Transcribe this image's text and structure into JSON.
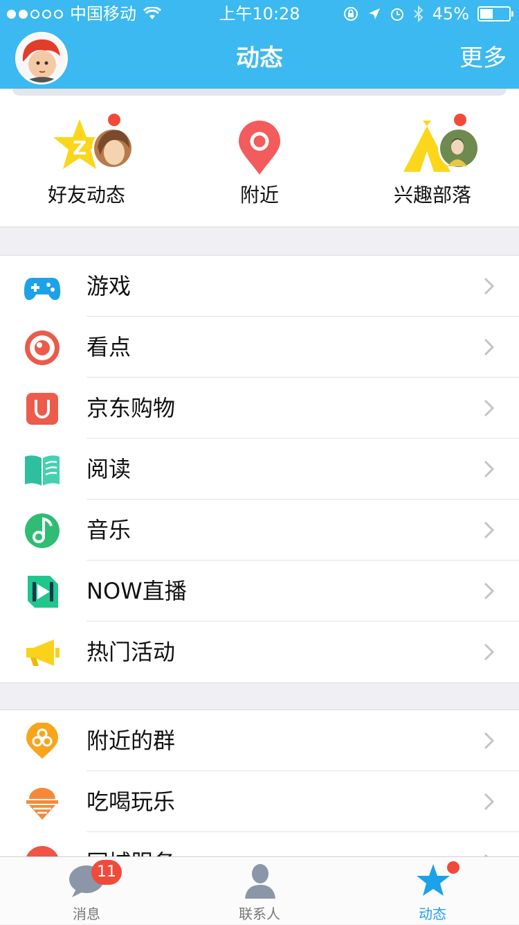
{
  "status_bar": {
    "carrier": "中国移动",
    "time": "上午10:28",
    "battery": "45%",
    "battery_level": 0.45,
    "icons": [
      "signal-dots-icon",
      "wifi-icon",
      "orientation-lock-icon",
      "location-icon",
      "alarm-icon",
      "bluetooth-icon",
      "battery-icon"
    ]
  },
  "navbar": {
    "title": "动态",
    "more": "更多"
  },
  "quick_entries": [
    {
      "label": "好友动态",
      "icon": "qzone-star-icon",
      "has_dot": true
    },
    {
      "label": "附近",
      "icon": "location-pin-icon",
      "has_dot": false
    },
    {
      "label": "兴趣部落",
      "icon": "tent-icon",
      "has_dot": true
    }
  ],
  "list_main": [
    {
      "label": "游戏",
      "icon": "gamepad-icon"
    },
    {
      "label": "看点",
      "icon": "eye-icon"
    },
    {
      "label": "京东购物",
      "icon": "shopping-bag-icon"
    },
    {
      "label": "阅读",
      "icon": "book-icon"
    },
    {
      "label": "音乐",
      "icon": "music-icon"
    },
    {
      "label": "NOW直播",
      "icon": "now-live-icon"
    },
    {
      "label": "热门活动",
      "icon": "megaphone-icon"
    }
  ],
  "list_secondary": [
    {
      "label": "附近的群",
      "icon": "group-pin-icon"
    },
    {
      "label": "吃喝玩乐",
      "icon": "icecream-icon"
    },
    {
      "label": "同城服务",
      "icon": "city-service-icon"
    }
  ],
  "tabbar": {
    "tabs": [
      {
        "label": "消息",
        "icon": "chat-bubble-icon",
        "badge": "11"
      },
      {
        "label": "联系人",
        "icon": "contact-person-icon"
      },
      {
        "label": "动态",
        "icon": "star-icon",
        "active": true,
        "has_dot": true
      }
    ]
  },
  "colors": {
    "header": "#3bb9f0",
    "accent": "#1da1e9",
    "badge": "#f24a3a"
  }
}
